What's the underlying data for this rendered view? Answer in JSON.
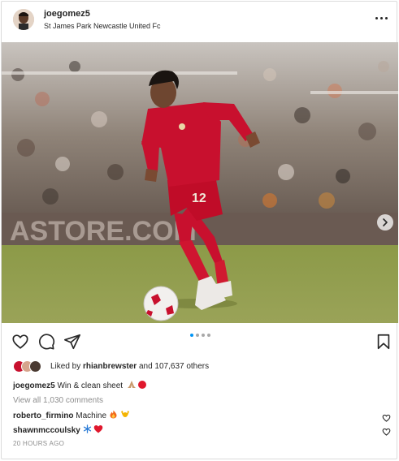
{
  "post": {
    "username": "joegomez5",
    "location": "St James Park Newcastle United Fc",
    "board_text": "ASTORE.COM",
    "shirt_number": "12",
    "carousel_total": 4,
    "carousel_active": 1
  },
  "likes": {
    "prefix": "Liked by ",
    "user": "rhianbrewster",
    "suffix": " and 107,637 others"
  },
  "caption": {
    "username": "joegomez5",
    "text": "Win & clean sheet"
  },
  "comments": {
    "view_all": "View all 1,030 comments",
    "items": [
      {
        "username": "roberto_firmino",
        "text": "Machine"
      },
      {
        "username": "shawnmccoulsky",
        "text": ""
      }
    ]
  },
  "timestamp": "20 HOURS AGO",
  "colors": {
    "accent_blue": "#0095f6",
    "liverpool_red": "#c8102e",
    "pitch_green": "#8a9a3e"
  },
  "icons": {
    "like": "heart-icon",
    "comment": "comment-icon",
    "share": "paper-plane-icon",
    "save": "bookmark-icon",
    "more": "more-horizontal-icon",
    "next": "chevron-right-icon"
  }
}
